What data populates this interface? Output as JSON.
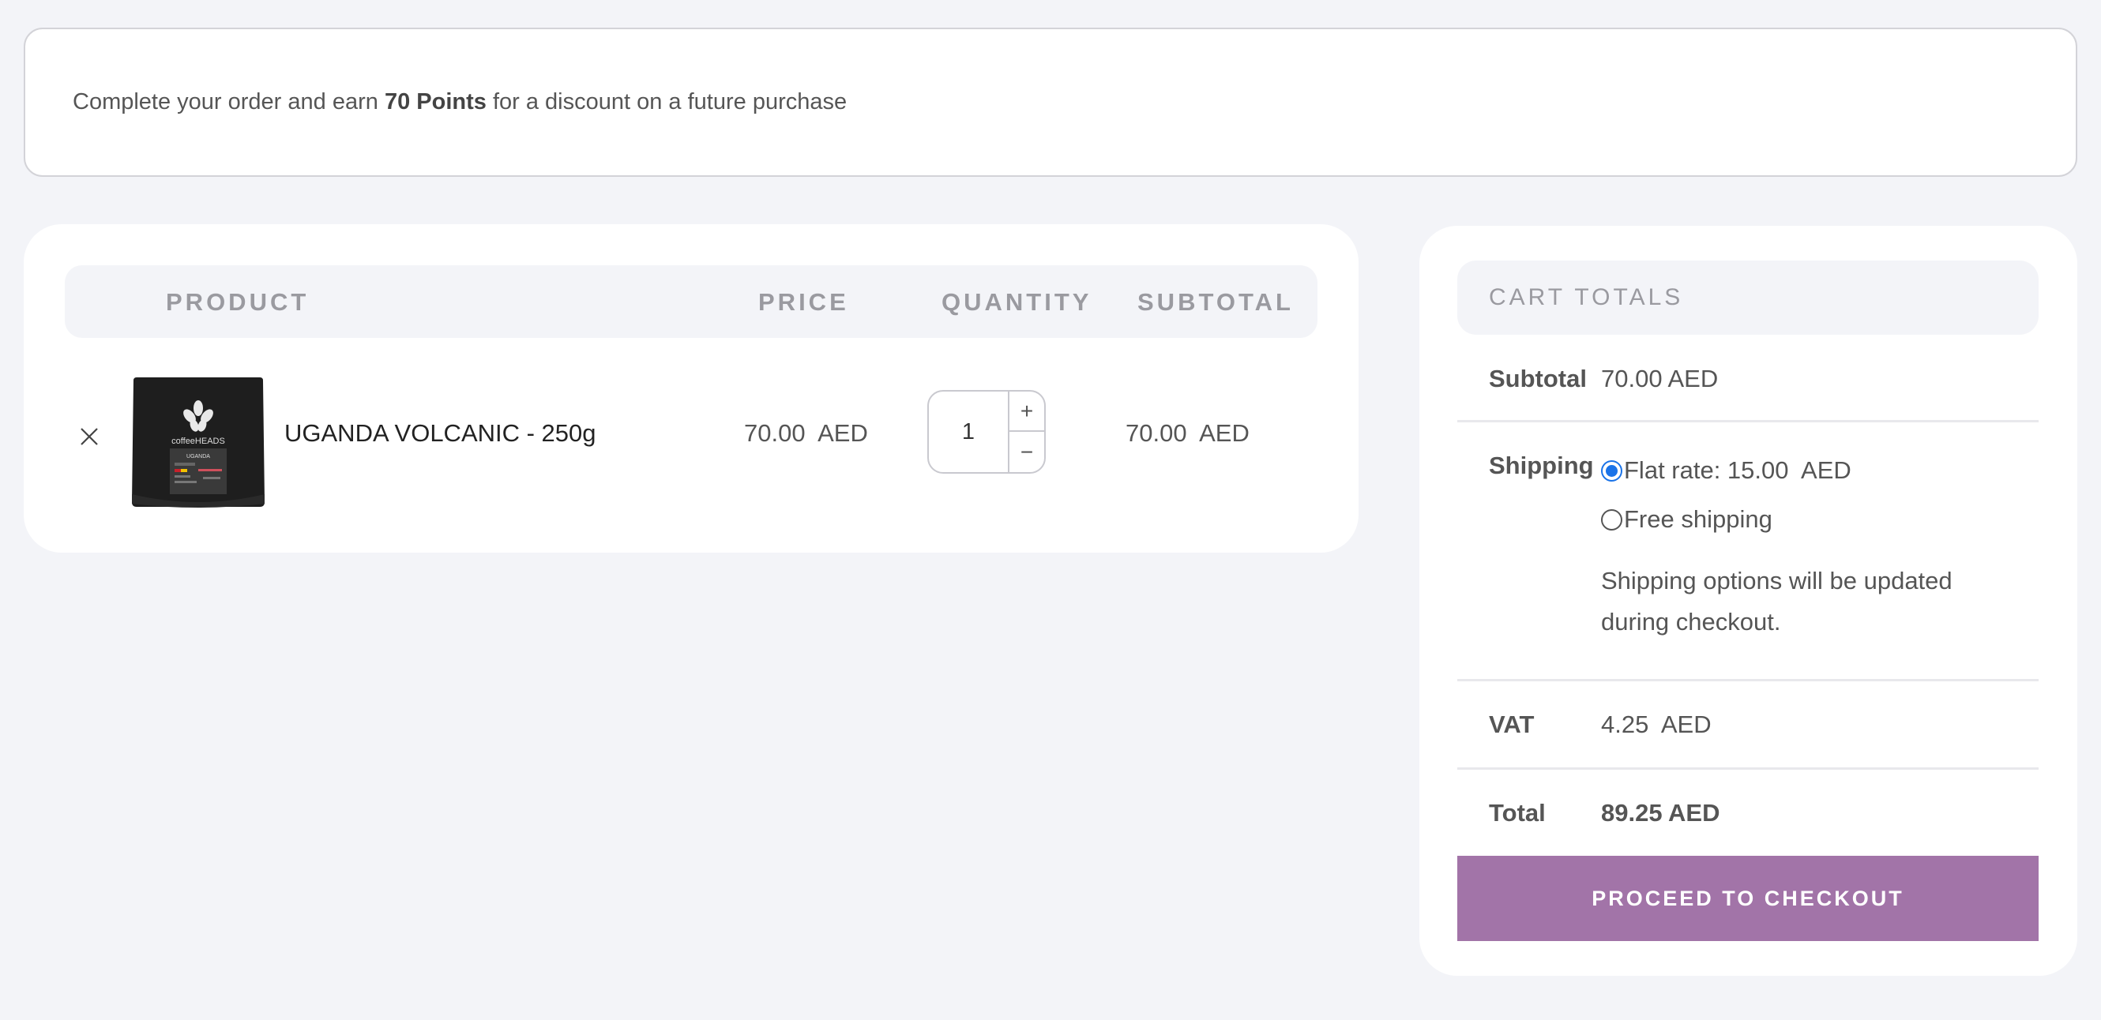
{
  "notice": {
    "prefix": "Complete your order and earn ",
    "points": "70 Points",
    "suffix": " for a discount on a future purchase"
  },
  "cart": {
    "headers": {
      "product": "PRODUCT",
      "price": "PRICE",
      "quantity": "QUANTITY",
      "subtotal": "SUBTOTAL"
    },
    "items": [
      {
        "remove_icon": "close-icon",
        "thumbnail_brand": "coffeeHEADS",
        "thumbnail_label": "UGANDA",
        "name": "UGANDA VOLCANIC - 250g",
        "price": "70.00  AED",
        "quantity": "1",
        "subtotal": "70.00  AED"
      }
    ],
    "qty_plus": "+",
    "qty_minus": "−"
  },
  "totals": {
    "title": "CART TOTALS",
    "subtotal_label": "Subtotal",
    "subtotal_value": "70.00  AED",
    "shipping_label": "Shipping",
    "shipping_options": [
      {
        "label": "Flat rate: 15.00  AED",
        "selected": true
      },
      {
        "label": "Free shipping",
        "selected": false
      }
    ],
    "shipping_note": "Shipping options will be updated during checkout.",
    "vat_label": "VAT",
    "vat_value": "4.25  AED",
    "total_label": "Total",
    "total_value": "89.25  AED",
    "checkout_label": "PROCEED TO CHECKOUT"
  },
  "colors": {
    "background": "#f3f4f8",
    "accent_button": "#a274a8",
    "radio_selected": "#1a73e8"
  }
}
